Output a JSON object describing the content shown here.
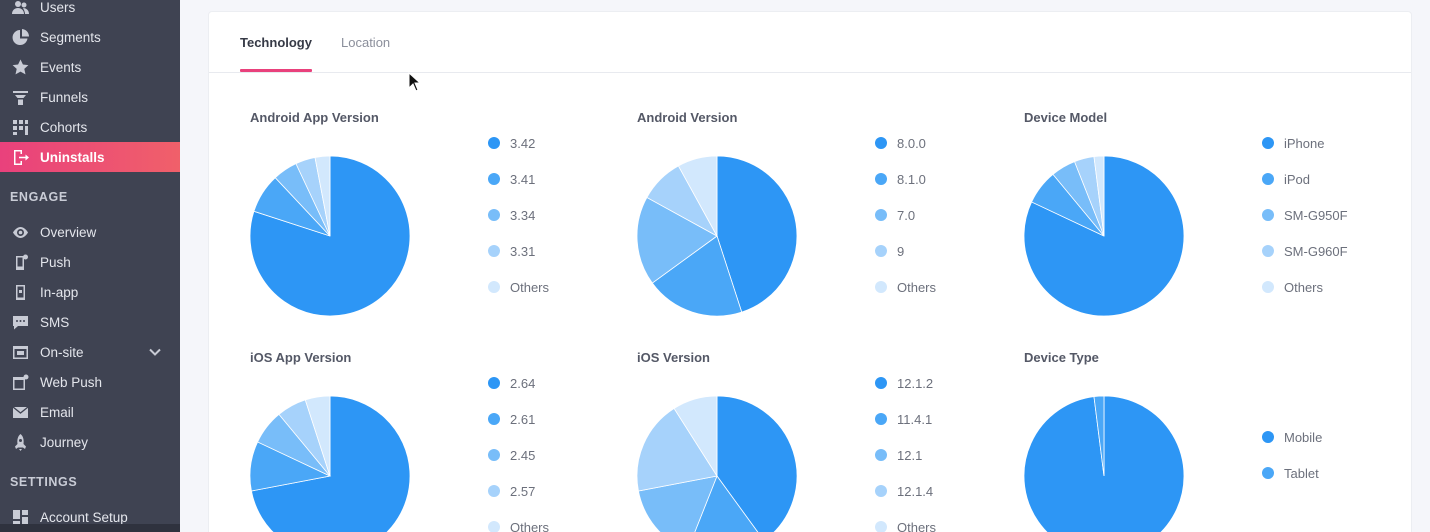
{
  "sidebar": {
    "items": [
      {
        "name": "users",
        "label": "Users",
        "icon": "users-icon"
      },
      {
        "name": "segments",
        "label": "Segments",
        "icon": "pie-segments-icon"
      },
      {
        "name": "events",
        "label": "Events",
        "icon": "star-events-icon"
      },
      {
        "name": "funnels",
        "label": "Funnels",
        "icon": "funnel-icon"
      },
      {
        "name": "cohorts",
        "label": "Cohorts",
        "icon": "cohorts-grid-icon"
      },
      {
        "name": "uninstalls",
        "label": "Uninstalls",
        "icon": "exit-uninstall-icon",
        "active": true
      }
    ],
    "engage_title": "ENGAGE",
    "engage_items": [
      {
        "name": "overview",
        "label": "Overview",
        "icon": "eye-icon"
      },
      {
        "name": "push",
        "label": "Push",
        "icon": "mobile-push-icon"
      },
      {
        "name": "in-app",
        "label": "In-app",
        "icon": "mobile-inapp-icon"
      },
      {
        "name": "sms",
        "label": "SMS",
        "icon": "chat-sms-icon"
      },
      {
        "name": "on-site",
        "label": "On-site",
        "icon": "window-onsite-icon",
        "expandable": true
      },
      {
        "name": "web-push",
        "label": "Web Push",
        "icon": "browser-webpush-icon"
      },
      {
        "name": "email",
        "label": "Email",
        "icon": "envelope-icon"
      },
      {
        "name": "journey",
        "label": "Journey",
        "icon": "rocket-journey-icon"
      }
    ],
    "settings_title": "SETTINGS",
    "settings_items": [
      {
        "name": "account-setup",
        "label": "Account Setup",
        "icon": "dashboard-icon"
      }
    ]
  },
  "tabs": [
    {
      "label": "Technology",
      "active": true
    },
    {
      "label": "Location",
      "active": false
    }
  ],
  "colors": {
    "accent": "#e9417c",
    "sidebar_bg": "#3f4352",
    "slice_1": "#2d96f5",
    "slice_2": "#4aa7f7",
    "slice_3": "#78bdf9",
    "slice_4": "#a6d2fb",
    "slice_5": "#d2e8fd"
  },
  "chart_data": [
    {
      "type": "pie",
      "title": "Android App Version",
      "categories": [
        "3.42",
        "3.41",
        "3.34",
        "3.31",
        "Others"
      ],
      "values": [
        80,
        8,
        5,
        4,
        3
      ]
    },
    {
      "type": "pie",
      "title": "Android Version",
      "categories": [
        "8.0.0",
        "8.1.0",
        "7.0",
        "9",
        "Others"
      ],
      "values": [
        45,
        20,
        18,
        9,
        8
      ]
    },
    {
      "type": "pie",
      "title": "Device Model",
      "categories": [
        "iPhone",
        "iPod",
        "SM-G950F",
        "SM-G960F",
        "Others"
      ],
      "values": [
        82,
        7,
        5,
        4,
        2
      ]
    },
    {
      "type": "pie",
      "title": "iOS App Version",
      "categories": [
        "2.64",
        "2.61",
        "2.45",
        "2.57",
        "Others"
      ],
      "values": [
        72,
        10,
        7,
        6,
        5
      ]
    },
    {
      "type": "pie",
      "title": "iOS Version",
      "categories": [
        "12.1.2",
        "11.4.1",
        "12.1",
        "12.1.4",
        "Others"
      ],
      "values": [
        40,
        16,
        16,
        19,
        9
      ]
    },
    {
      "type": "pie",
      "title": "Device Type",
      "categories": [
        "Mobile",
        "Tablet"
      ],
      "values": [
        98,
        2
      ]
    }
  ]
}
